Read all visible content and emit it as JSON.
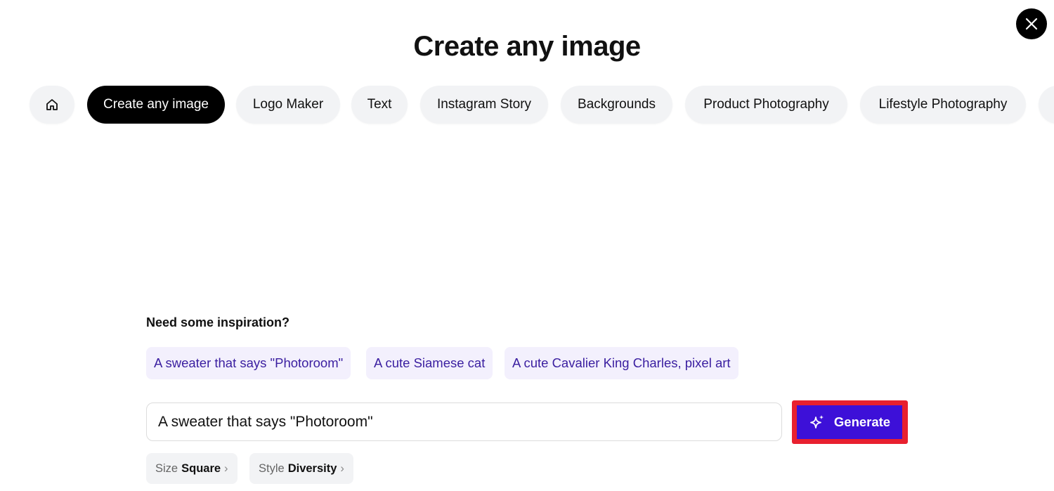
{
  "title": "Create any image",
  "tabs": [
    {
      "icon": "home-icon"
    },
    {
      "label": "Create any image",
      "active": true
    },
    {
      "label": "Logo Maker"
    },
    {
      "label": "Text"
    },
    {
      "label": "Instagram Story"
    },
    {
      "label": "Backgrounds"
    },
    {
      "label": "Product Photography"
    },
    {
      "label": "Lifestyle Photography"
    }
  ],
  "inspiration": {
    "heading": "Need some inspiration?",
    "chips": [
      "A sweater that says \"Photoroom\"",
      "A cute Siamese cat",
      "A cute Cavalier King Charles, pixel art"
    ]
  },
  "prompt": {
    "value": "A sweater that says \"Photoroom\""
  },
  "generate": {
    "label": "Generate",
    "color": "#3d10d8",
    "highlight": "#e8202f"
  },
  "options": [
    {
      "key": "Size",
      "value": "Square"
    },
    {
      "key": "Style",
      "value": "Diversity"
    }
  ]
}
